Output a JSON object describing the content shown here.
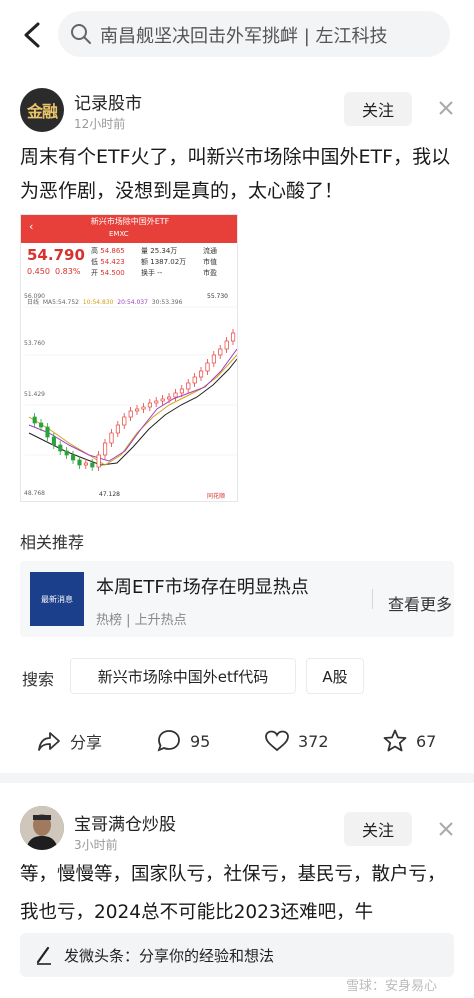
{
  "search": {
    "query": "南昌舰坚决回击外军挑衅 | 左江科技"
  },
  "post1": {
    "avatar_text": "金融",
    "author": "记录股市",
    "time": "12小时前",
    "follow_label": "关注",
    "text": "周末有个ETF火了，叫新兴市场除中国外ETF，我以为恶作剧，没想到是真的，太心酸了！"
  },
  "stock": {
    "title": "新兴市场除中国外ETF",
    "code": "EMXC",
    "price": "54.790",
    "change_abs": "0.450",
    "change_pct": "0.83%",
    "high_label": "高",
    "high": "54.865",
    "low_label": "低",
    "low": "54.423",
    "open_label": "开",
    "open": "54.500",
    "vol_label": "量",
    "vol": "25.34万",
    "amt_label": "额",
    "amt": "1387.02万",
    "turn_label": "换手",
    "turn": "--",
    "c1_label": "流通",
    "c2_label": "市值",
    "c3_label": "市盈",
    "ma_label": "日线",
    "ma5": "MA5:54.752",
    "ma10": "10:54.830",
    "ma20": "20:54.037",
    "ma30": "30:53.396",
    "ytick_top": "56.090",
    "ytick_mid": "53.760",
    "ytick_low": "51.429",
    "ytick_bottom": "48.768",
    "max_label": "55.730",
    "min_label": "47.128",
    "watermark": "同花顺"
  },
  "related": {
    "heading": "相关推荐",
    "thumb_text": "最新消息",
    "title": "本周ETF市场存在明显热点",
    "sub": "热榜 | 上升热点",
    "more": "查看更多"
  },
  "search_row": {
    "label": "搜索",
    "chips": [
      "新兴市场除中国外etf代码",
      "A股"
    ]
  },
  "actions": {
    "share": "分享",
    "comments": "95",
    "likes": "372",
    "favorites": "67"
  },
  "post2": {
    "author": "宝哥满仓炒股",
    "time": "3小时前",
    "follow_label": "关注",
    "text": "等，慢慢等，国家队亏，社保亏，基民亏，散户亏，我也亏，2024总不可能比2023还难吧，牛"
  },
  "comment_bar": {
    "placeholder": "发微头条：分享你的经验和想法"
  },
  "watermark": "雪球：安身易心",
  "colors": {
    "accent_red": "#e7403b",
    "chart_green": "#2aa33a"
  }
}
